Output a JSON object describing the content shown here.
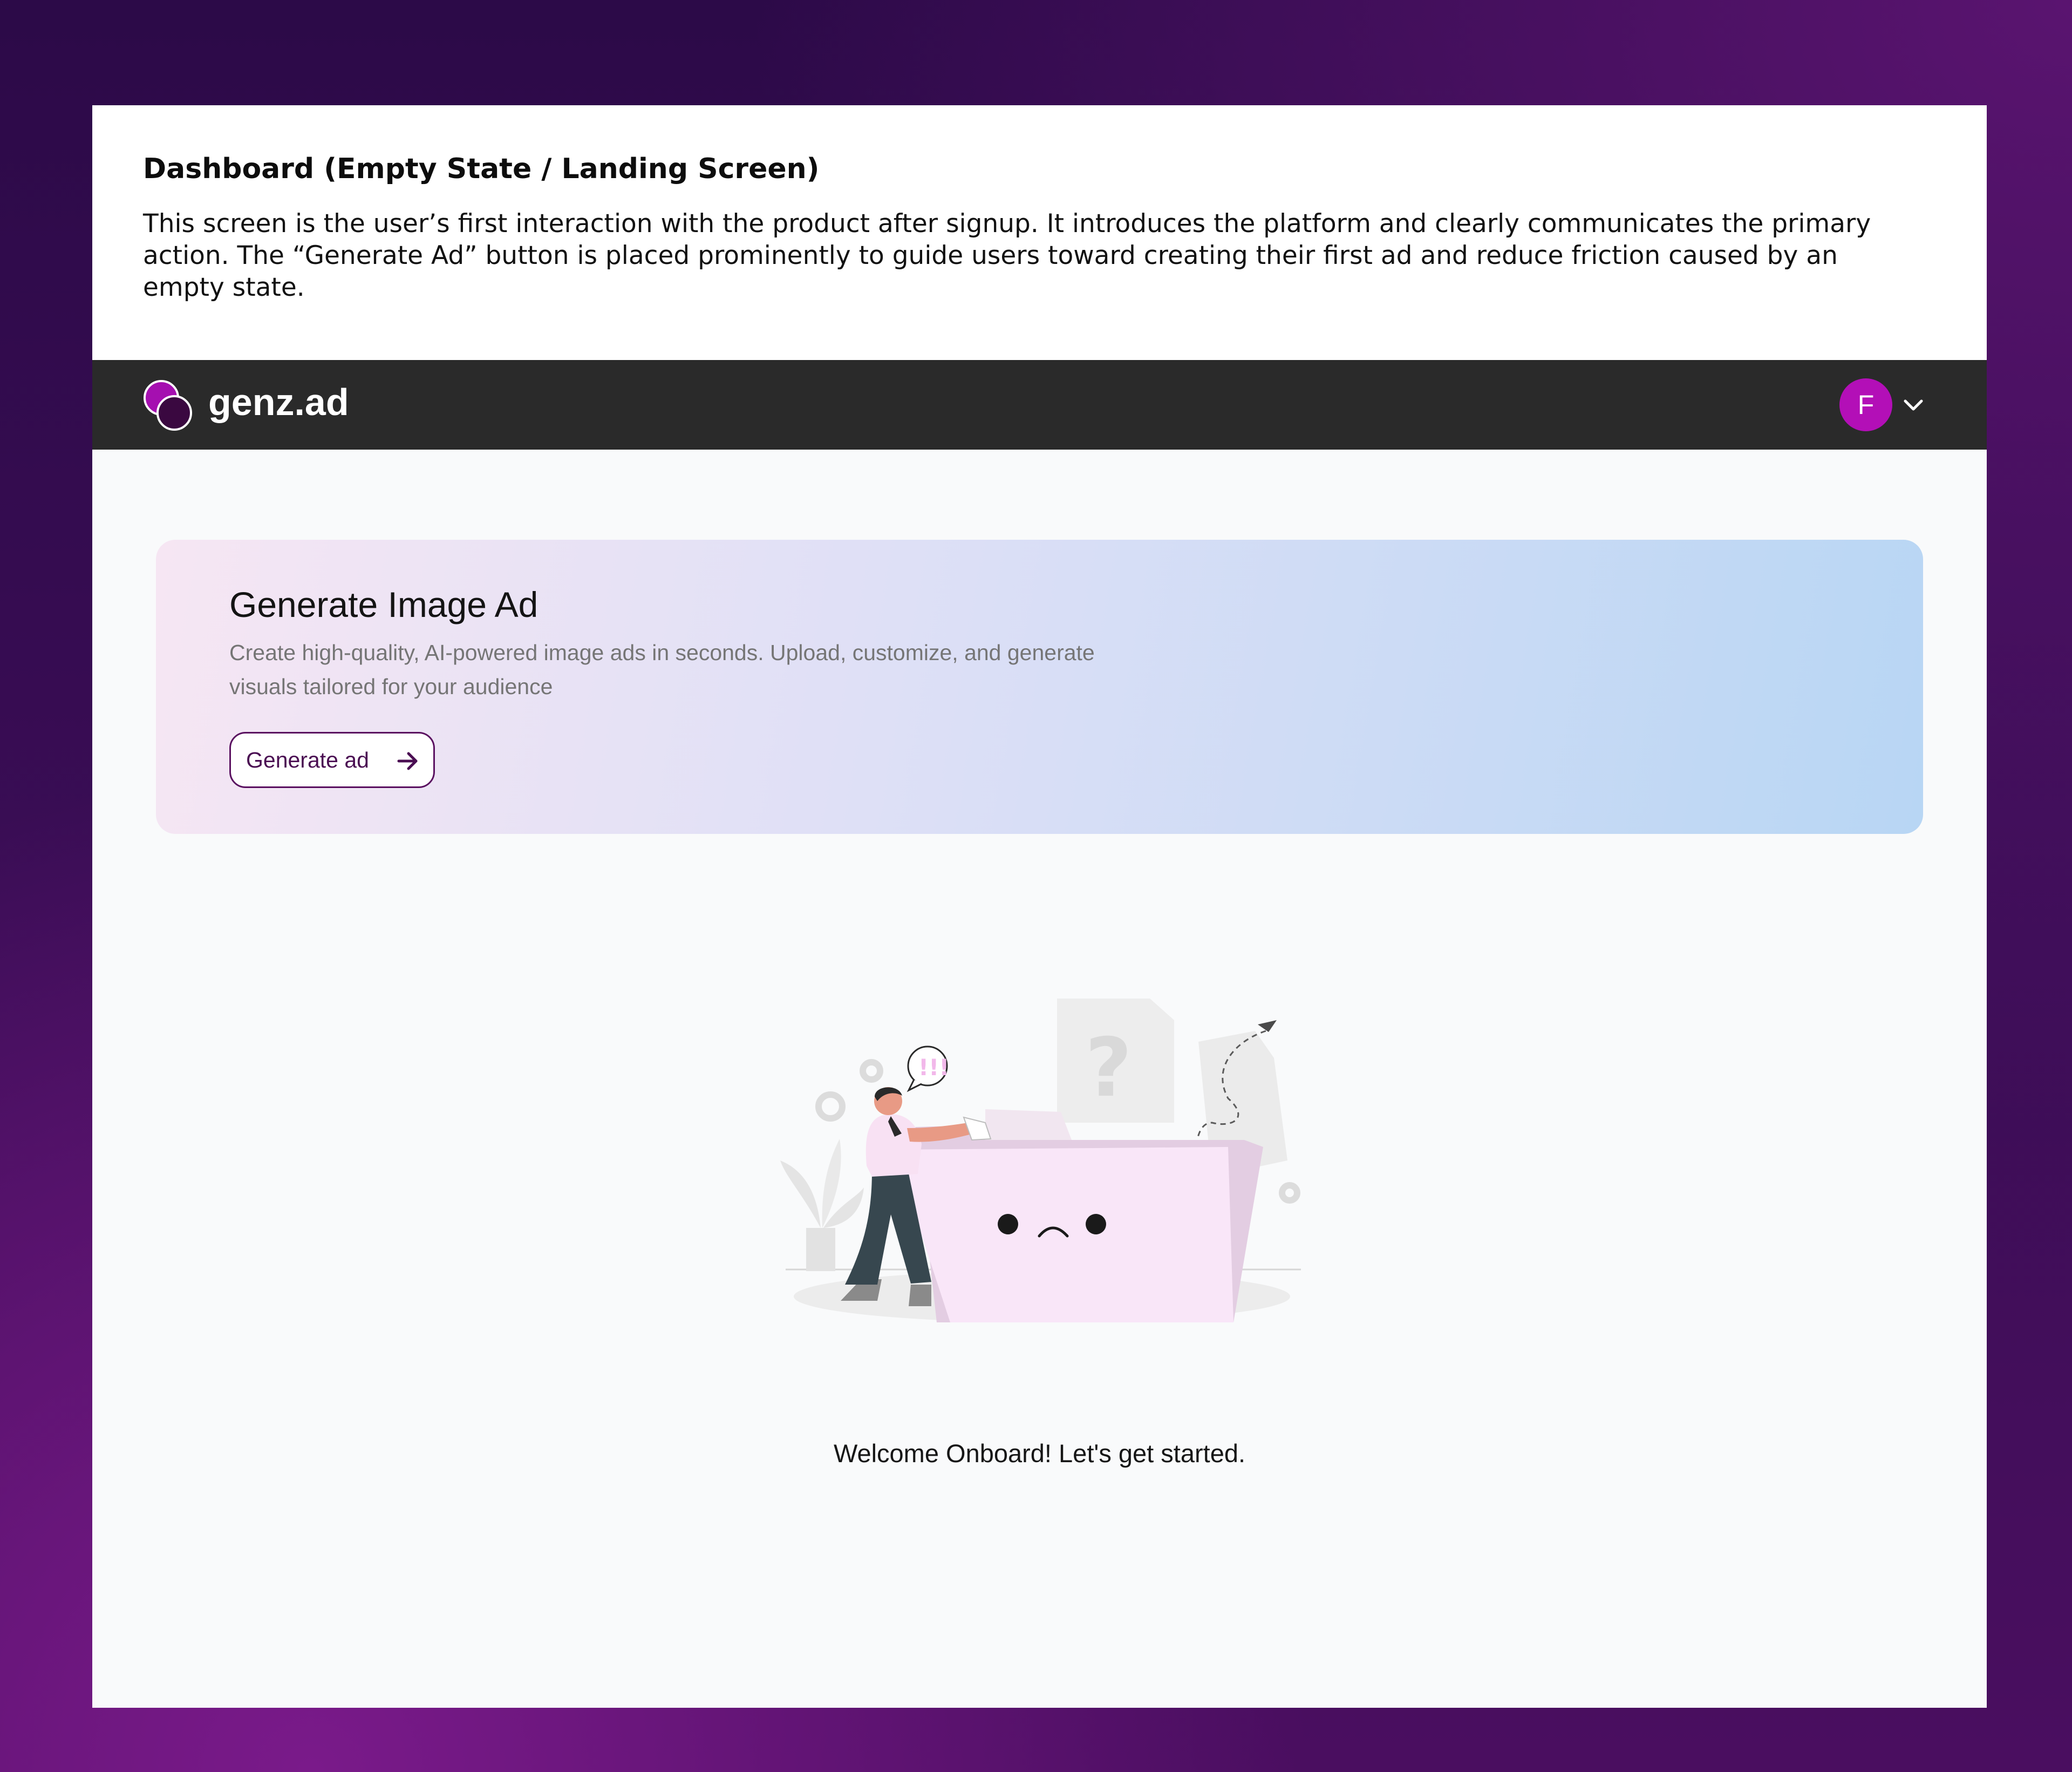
{
  "description": {
    "title": "Dashboard (Empty State / Landing Screen)",
    "body": "This screen is the user’s first interaction with the product after signup. It introduces the platform and clearly communicates the primary action. The “Generate Ad” button is placed prominently to guide users toward creating their first ad and reduce friction caused by an empty state."
  },
  "header": {
    "logo_text": "genz.ad",
    "avatar_initial": "F",
    "logo_icon": "overlapping-circles-icon",
    "menu_icon": "chevron-down-icon"
  },
  "banner": {
    "title": "Generate Image Ad",
    "description": "Create high-quality, AI-powered image ads in seconds. Upload, customize, and generate visuals tailored for your audience",
    "button_label": "Generate ad",
    "button_icon": "arrow-right-icon"
  },
  "empty_state": {
    "illustration": "empty-folder-illustration",
    "message": "Welcome Onboard! Let's get started."
  },
  "colors": {
    "brand": "#b30fb7",
    "brand_dark": "#4a0d52",
    "topbar": "#2a2a2a"
  }
}
